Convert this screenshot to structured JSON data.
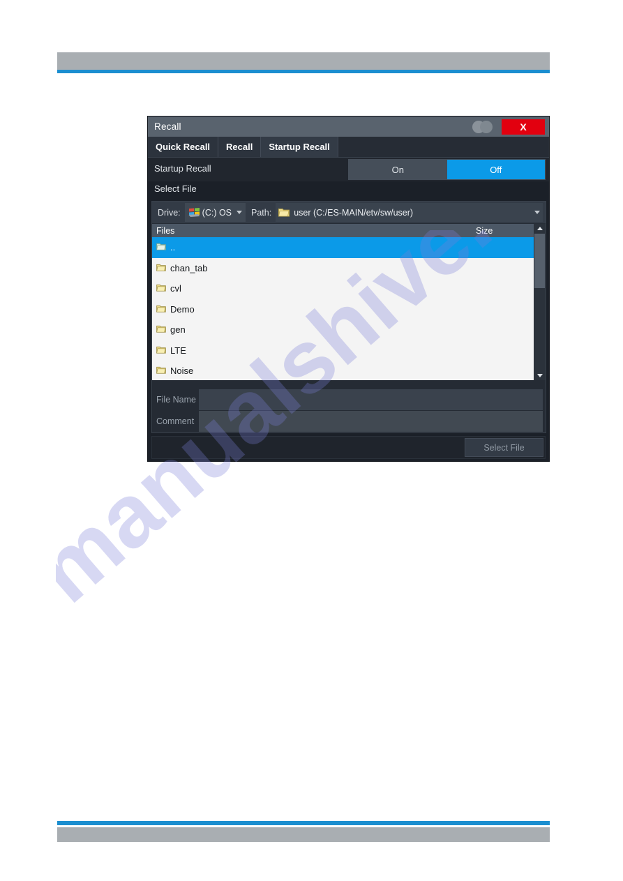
{
  "dialog": {
    "title": "Recall",
    "close_label": "X",
    "tabs": [
      {
        "label": "Quick Recall",
        "active": false
      },
      {
        "label": "Recall",
        "active": false
      },
      {
        "label": "Startup Recall",
        "active": true
      }
    ],
    "startup_recall": {
      "label": "Startup Recall",
      "options": [
        {
          "label": "On",
          "selected": false
        },
        {
          "label": "Off",
          "selected": true
        }
      ]
    },
    "select_file": {
      "section_label": "Select File",
      "drive_label": "Drive:",
      "drive_value": "(C:) OS",
      "path_label": "Path:",
      "path_value": "user (C:/ES-MAIN/etv/sw/user)",
      "columns": {
        "files": "Files",
        "size": "Size"
      },
      "rows": [
        {
          "name": "..",
          "size": "",
          "selected": true
        },
        {
          "name": "chan_tab",
          "size": "",
          "selected": false
        },
        {
          "name": "cvl",
          "size": "",
          "selected": false
        },
        {
          "name": "Demo",
          "size": "",
          "selected": false
        },
        {
          "name": "gen",
          "size": "",
          "selected": false
        },
        {
          "name": "LTE",
          "size": "",
          "selected": false
        },
        {
          "name": "Noise",
          "size": "",
          "selected": false
        }
      ],
      "file_name_label": "File Name",
      "file_name_value": "",
      "comment_label": "Comment",
      "comment_value": ""
    },
    "footer": {
      "select_file_button": "Select File"
    }
  },
  "page": {
    "watermark_text": "manualshive.com"
  },
  "colors": {
    "accent_blue": "#0b9ae8",
    "band_grey": "#a9aeb2",
    "rule_blue": "#1b8ed0",
    "close_red": "#e2000f",
    "dialog_bg": "#1b2028",
    "titlebar": "#59636e",
    "folder_yellow": "#e8e08a"
  }
}
